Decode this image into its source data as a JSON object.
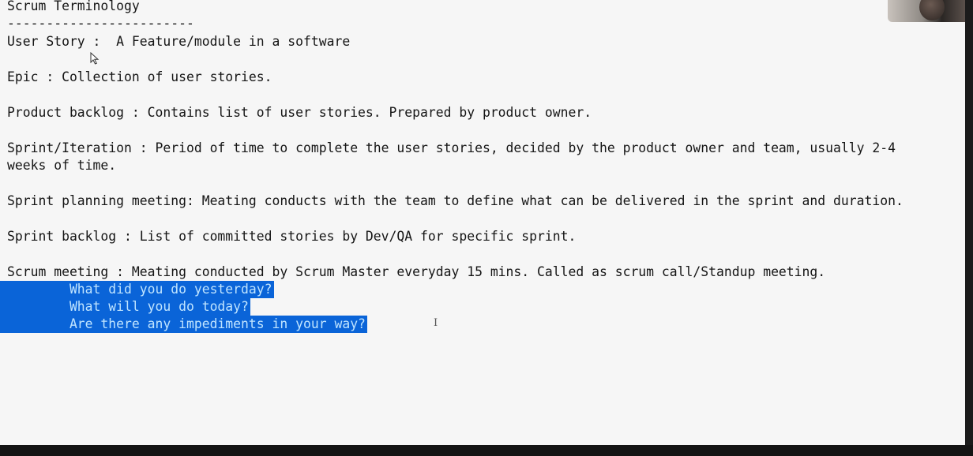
{
  "document": {
    "title": "Scrum Terminology",
    "underline": "------------------------",
    "lines": [
      "User Story :  A Feature/module in a software",
      "Epic : Collection of user stories.",
      "Product backlog : Contains list of user stories. Prepared by product owner.",
      "Sprint/Iteration : Period of time to complete the user stories, decided by the product owner and team, usually 2-4",
      "weeks of time.",
      "Sprint planning meeting: Meating conducts with the team to define what can be delivered in the sprint and duration.",
      "Sprint backlog : List of committed stories by Dev/QA for specific sprint.",
      "Scrum meeting : Meating conducted by Scrum Master everyday 15 mins. Called as scrum call/Standup meeting."
    ],
    "selected_lines": [
      "        What did you do yesterday?",
      "        What will you do today?",
      "        Are there any impediments in your way?"
    ]
  },
  "colors": {
    "background": "#f6f6f6",
    "text": "#151515",
    "selection": "#0a64d8",
    "selection_text": "#bfe4ff"
  },
  "icons": {
    "mouse_cursor": "arrow-cursor-icon",
    "text_cursor": "i-beam-cursor-icon"
  }
}
